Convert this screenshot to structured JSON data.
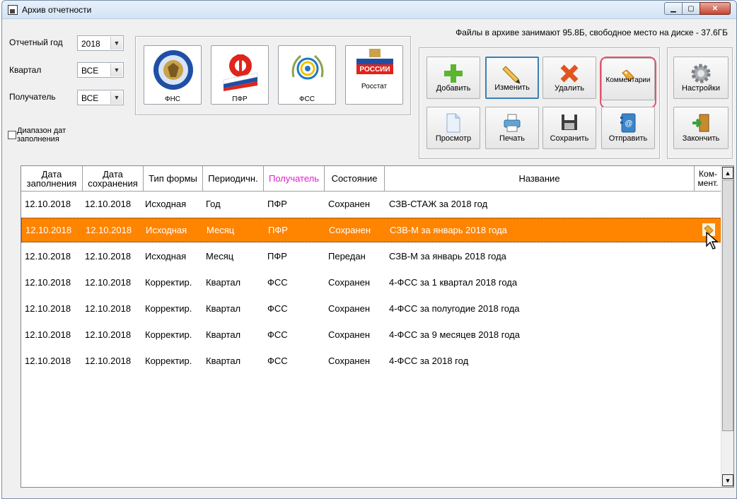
{
  "window": {
    "title": "Архив отчетности",
    "controls": [
      "minimize",
      "maximize",
      "close"
    ]
  },
  "filters": {
    "year_label": "Отчетный год",
    "year_value": "2018",
    "quarter_label": "Квартал",
    "quarter_value": "ВСЕ",
    "recipient_label": "Получатель",
    "recipient_value": "ВСЕ",
    "date_range_label_line1": "Диапазон дат",
    "date_range_label_line2": "заполнения",
    "date_range_checked": false
  },
  "recipients": [
    {
      "label": "ФНС",
      "icon": "fns-emblem-icon"
    },
    {
      "label": "ПФР",
      "icon": "pfr-logo-icon"
    },
    {
      "label": "ФСС",
      "icon": "fss-emblem-icon"
    },
    {
      "label": "Росстат",
      "icon": "rosstat-logo-icon"
    }
  ],
  "archive_info": "Файлы в архиве занимают 95.8Б,  свободное место на диске - 37.6ГБ",
  "toolbar": {
    "add": "Добавить",
    "edit": "Изменить",
    "delete": "Удалить",
    "comments": "Комментарии",
    "view": "Просмотр",
    "print": "Печать",
    "save": "Сохранить",
    "send": "Отправить",
    "settings": "Настройки",
    "finish": "Закончить"
  },
  "colors": {
    "selected_row": "#ff8400",
    "recipient_header": "#e31ecb",
    "highlight_ring": "#e0556b",
    "focus_border": "#3c7fb1"
  },
  "table": {
    "columns": [
      {
        "line1": "Дата",
        "line2": "заполнения"
      },
      {
        "line1": "Дата",
        "line2": "сохранения"
      },
      {
        "line1": "Тип формы",
        "line2": ""
      },
      {
        "line1": "Периодичн.",
        "line2": ""
      },
      {
        "line1": "Получатель",
        "line2": ""
      },
      {
        "line1": "Состояние",
        "line2": ""
      },
      {
        "line1": "Название",
        "line2": ""
      },
      {
        "line1": "Ком-",
        "line2": "мент."
      }
    ],
    "rows": [
      {
        "filled": "12.10.2018",
        "saved": "12.10.2018",
        "type": "Исходная",
        "period": "Год",
        "recipient": "ПФР",
        "state": "Сохранен",
        "name": "СЗВ-СТАЖ за 2018 год",
        "has_comment": false,
        "selected": false
      },
      {
        "filled": "12.10.2018",
        "saved": "12.10.2018",
        "type": "Исходная",
        "period": "Месяц",
        "recipient": "ПФР",
        "state": "Сохранен",
        "name": "СЗВ-М за январь 2018 года",
        "has_comment": true,
        "selected": true
      },
      {
        "filled": "12.10.2018",
        "saved": "12.10.2018",
        "type": "Исходная",
        "period": "Месяц",
        "recipient": "ПФР",
        "state": "Передан",
        "name": "СЗВ-М за январь 2018 года",
        "has_comment": false,
        "selected": false
      },
      {
        "filled": "12.10.2018",
        "saved": "12.10.2018",
        "type": "Корректир.",
        "period": "Квартал",
        "recipient": "ФСС",
        "state": "Сохранен",
        "name": "4-ФСС за 1 квартал 2018 года",
        "has_comment": false,
        "selected": false
      },
      {
        "filled": "12.10.2018",
        "saved": "12.10.2018",
        "type": "Корректир.",
        "period": "Квартал",
        "recipient": "ФСС",
        "state": "Сохранен",
        "name": "4-ФСС за полугодие 2018 года",
        "has_comment": false,
        "selected": false
      },
      {
        "filled": "12.10.2018",
        "saved": "12.10.2018",
        "type": "Корректир.",
        "period": "Квартал",
        "recipient": "ФСС",
        "state": "Сохранен",
        "name": "4-ФСС за 9 месяцев 2018 года",
        "has_comment": false,
        "selected": false
      },
      {
        "filled": "12.10.2018",
        "saved": "12.10.2018",
        "type": "Корректир.",
        "period": "Квартал",
        "recipient": "ФСС",
        "state": "Сохранен",
        "name": "4-ФСС за 2018 год",
        "has_comment": false,
        "selected": false
      }
    ]
  }
}
